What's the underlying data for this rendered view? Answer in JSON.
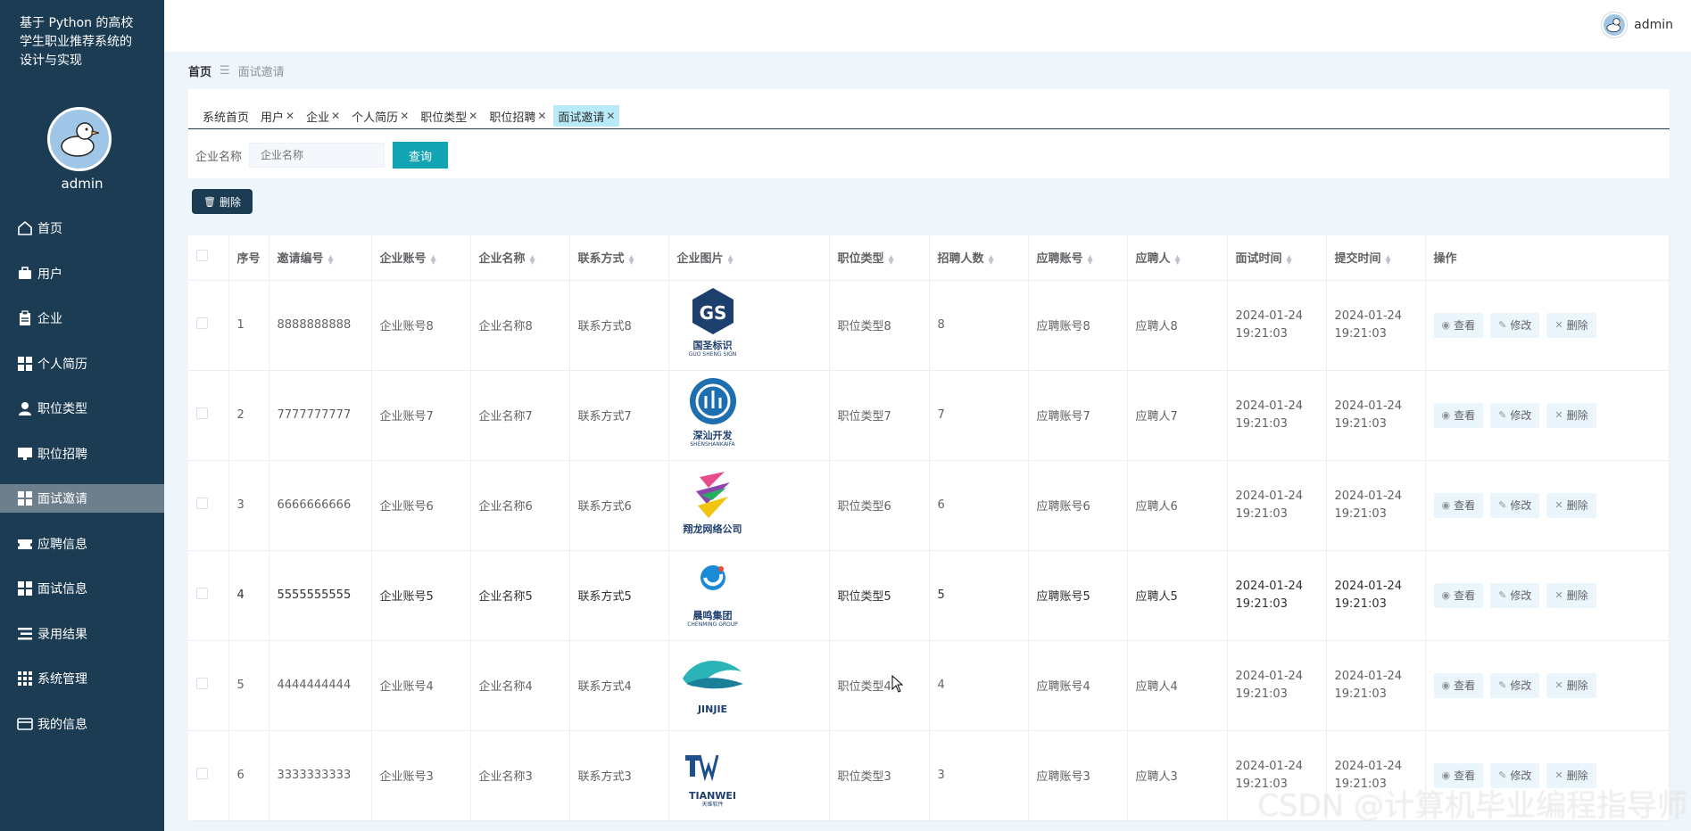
{
  "app": {
    "title_lines": [
      "基于 Python 的高校",
      "学生职业推荐系统的",
      "设计与实现"
    ],
    "side_username": "admin"
  },
  "topbar": {
    "username": "admin"
  },
  "sidebar": {
    "items": [
      {
        "label": "首页",
        "icon": "home-icon"
      },
      {
        "label": "用户",
        "icon": "briefcase-icon"
      },
      {
        "label": "企业",
        "icon": "clipboard-icon"
      },
      {
        "label": "个人简历",
        "icon": "grid-icon"
      },
      {
        "label": "职位类型",
        "icon": "person-icon"
      },
      {
        "label": "职位招聘",
        "icon": "monitor-icon"
      },
      {
        "label": "面试邀请",
        "icon": "grid-icon",
        "active": true
      },
      {
        "label": "应聘信息",
        "icon": "ticket-icon"
      },
      {
        "label": "面试信息",
        "icon": "grid-icon"
      },
      {
        "label": "录用结果",
        "icon": "list-icon"
      },
      {
        "label": "系统管理",
        "icon": "apps-icon"
      },
      {
        "label": "我的信息",
        "icon": "card-icon"
      }
    ]
  },
  "breadcrumb": {
    "home": "首页",
    "separator": "☰",
    "current": "面试邀请"
  },
  "tabs": [
    {
      "label": "系统首页",
      "closable": false
    },
    {
      "label": "用户",
      "closable": true
    },
    {
      "label": "企业",
      "closable": true
    },
    {
      "label": "个人简历",
      "closable": true
    },
    {
      "label": "职位类型",
      "closable": true
    },
    {
      "label": "职位招聘",
      "closable": true
    },
    {
      "label": "面试邀请",
      "closable": true,
      "active": true
    }
  ],
  "search": {
    "label": "企业名称",
    "placeholder": "企业名称",
    "button": "查询"
  },
  "actions": {
    "delete": "删除"
  },
  "table": {
    "headers": [
      "序号",
      "邀请编号",
      "企业账号",
      "企业名称",
      "联系方式",
      "企业图片",
      "职位类型",
      "招聘人数",
      "应聘账号",
      "应聘人",
      "面试时间",
      "提交时间",
      "操作"
    ],
    "op_labels": {
      "view": "查看",
      "edit": "修改",
      "delete": "删除"
    },
    "rows": [
      {
        "no": "1",
        "invite_id": "8888888888",
        "account": "企业账号8",
        "name": "企业名称8",
        "contact": "联系方式8",
        "logo": {
          "title": "国圣标识",
          "sub": "GUO SHENG SIGN"
        },
        "job_type": "职位类型8",
        "count": "8",
        "applicant_account": "应聘账号8",
        "applicant": "应聘人8",
        "interview_time": "2024-01-24 19:21:03",
        "submit_time": "2024-01-24 19:21:03"
      },
      {
        "no": "2",
        "invite_id": "7777777777",
        "account": "企业账号7",
        "name": "企业名称7",
        "contact": "联系方式7",
        "logo": {
          "title": "深汕开发",
          "sub": "SHENSHANKAIFA"
        },
        "job_type": "职位类型7",
        "count": "7",
        "applicant_account": "应聘账号7",
        "applicant": "应聘人7",
        "interview_time": "2024-01-24 19:21:03",
        "submit_time": "2024-01-24 19:21:03"
      },
      {
        "no": "3",
        "invite_id": "6666666666",
        "account": "企业账号6",
        "name": "企业名称6",
        "contact": "联系方式6",
        "logo": {
          "title": "翔龙网络公司",
          "sub": ""
        },
        "job_type": "职位类型6",
        "count": "6",
        "applicant_account": "应聘账号6",
        "applicant": "应聘人6",
        "interview_time": "2024-01-24 19:21:03",
        "submit_time": "2024-01-24 19:21:03"
      },
      {
        "no": "4",
        "invite_id": "5555555555",
        "account": "企业账号5",
        "name": "企业名称5",
        "contact": "联系方式5",
        "logo": {
          "title": "晨鸣集团",
          "sub": "CHENMING GROUP"
        },
        "job_type": "职位类型5",
        "count": "5",
        "applicant_account": "应聘账号5",
        "applicant": "应聘人5",
        "interview_time": "2024-01-24 19:21:03",
        "submit_time": "2024-01-24 19:21:03"
      },
      {
        "no": "5",
        "invite_id": "4444444444",
        "account": "企业账号4",
        "name": "企业名称4",
        "contact": "联系方式4",
        "logo": {
          "title": "JINJIE",
          "sub": ""
        },
        "job_type": "职位类型4",
        "count": "4",
        "applicant_account": "应聘账号4",
        "applicant": "应聘人4",
        "interview_time": "2024-01-24 19:21:03",
        "submit_time": "2024-01-24 19:21:03"
      },
      {
        "no": "6",
        "invite_id": "3333333333",
        "account": "企业账号3",
        "name": "企业名称3",
        "contact": "联系方式3",
        "logo": {
          "title": "TIANWEI",
          "sub": "天维软件"
        },
        "job_type": "职位类型3",
        "count": "3",
        "applicant_account": "应聘账号3",
        "applicant": "应聘人3",
        "interview_time": "2024-01-24 19:21:03",
        "submit_time": "2024-01-24 19:21:03"
      }
    ]
  },
  "watermark": "CSDN @计算机毕业编程指导师"
}
